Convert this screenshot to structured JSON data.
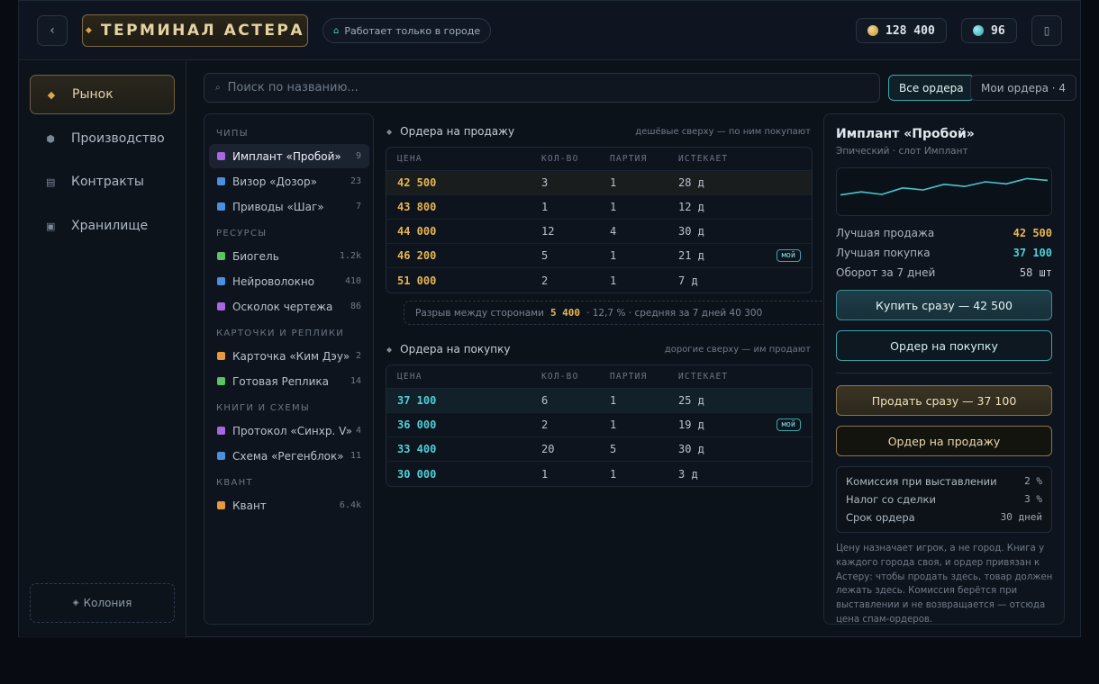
{
  "header": {
    "back_label": "‹",
    "title": "ТЕРМИНАЛ АСТЕРА",
    "city_note": "Работает только в городе",
    "gold": "128 400",
    "gems": "96",
    "menu_label": "▯"
  },
  "sidebar": {
    "items": [
      {
        "label": "Рынок",
        "icon": "diamond-icon"
      },
      {
        "label": "Производство",
        "icon": "hexagon-icon"
      },
      {
        "label": "Контракты",
        "icon": "document-icon"
      },
      {
        "label": "Хранилище",
        "icon": "storage-icon"
      }
    ],
    "colony": "Колония"
  },
  "search": {
    "placeholder": "Поиск по названию..."
  },
  "filters": {
    "all": "Все ордера",
    "mine": "Мои ордера · 4"
  },
  "categories": [
    {
      "title": "ЧИПЫ",
      "items": [
        {
          "name": "Имплант «Пробой»",
          "count": "9",
          "color": "#a866e0"
        },
        {
          "name": "Визор «Дозор»",
          "count": "23",
          "color": "#4a8fe0"
        },
        {
          "name": "Приводы «Шаг»",
          "count": "7",
          "color": "#4a8fe0"
        }
      ]
    },
    {
      "title": "РЕСУРСЫ",
      "items": [
        {
          "name": "Биогель",
          "count": "1.2k",
          "color": "#5cc263"
        },
        {
          "name": "Нейроволокно",
          "count": "410",
          "color": "#4a8fe0"
        },
        {
          "name": "Осколок чертежа",
          "count": "86",
          "color": "#a866e0"
        }
      ]
    },
    {
      "title": "КАРТОЧКИ И РЕПЛИКИ",
      "items": [
        {
          "name": "Карточка «Ким Дэу»",
          "count": "2",
          "color": "#e69a3c"
        },
        {
          "name": "Готовая Реплика",
          "count": "14",
          "color": "#5cc263"
        }
      ]
    },
    {
      "title": "КНИГИ И СХЕМЫ",
      "items": [
        {
          "name": "Протокол «Синхр. V»",
          "count": "4",
          "color": "#a866e0"
        },
        {
          "name": "Схема «Регенблок»",
          "count": "11",
          "color": "#4a8fe0"
        }
      ]
    },
    {
      "title": "КВАНТ",
      "items": [
        {
          "name": "Квант",
          "count": "6.4k",
          "color": "#e69a3c"
        }
      ]
    }
  ],
  "sell": {
    "title": "Ордера на продажу",
    "hint": "дешёвые сверху — по ним покупают",
    "columns": [
      "ЦЕНА",
      "КОЛ-ВО",
      "ПАРТИЯ",
      "ИСТЕКАЕТ"
    ],
    "rows": [
      {
        "price": "42 500",
        "qty": "3",
        "lot": "1",
        "exp": "28 д",
        "mine": ""
      },
      {
        "price": "43 800",
        "qty": "1",
        "lot": "1",
        "exp": "12 д",
        "mine": ""
      },
      {
        "price": "44 000",
        "qty": "12",
        "lot": "4",
        "exp": "30 д",
        "mine": ""
      },
      {
        "price": "46 200",
        "qty": "5",
        "lot": "1",
        "exp": "21 д",
        "mine": "мой"
      },
      {
        "price": "51 000",
        "qty": "2",
        "lot": "1",
        "exp": "7 д",
        "mine": ""
      }
    ]
  },
  "spread": {
    "label": "Разрыв между сторонами",
    "value": "5 400",
    "detail": "· 12,7 % · средняя за 7 дней 40 300"
  },
  "buy": {
    "title": "Ордера на покупку",
    "hint": "дорогие сверху — им продают",
    "columns": [
      "ЦЕНА",
      "КОЛ-ВО",
      "ПАРТИЯ",
      "ИСТЕКАЕТ"
    ],
    "rows": [
      {
        "price": "37 100",
        "qty": "6",
        "lot": "1",
        "exp": "25 д",
        "mine": ""
      },
      {
        "price": "36 000",
        "qty": "2",
        "lot": "1",
        "exp": "19 д",
        "mine": "мой"
      },
      {
        "price": "33 400",
        "qty": "20",
        "lot": "5",
        "exp": "30 д",
        "mine": ""
      },
      {
        "price": "30 000",
        "qty": "1",
        "lot": "1",
        "exp": "3 д",
        "mine": ""
      }
    ]
  },
  "detail": {
    "title": "Имплант «Пробой»",
    "subtitle": "Эпический · слот Имплант",
    "sparkline": [
      0.3,
      0.42,
      0.32,
      0.58,
      0.5,
      0.72,
      0.64,
      0.82,
      0.74,
      0.95,
      0.88
    ],
    "best_sell_label": "Лучшая продажа",
    "best_sell": "42 500",
    "best_buy_label": "Лучшая покупка",
    "best_buy": "37 100",
    "turnover_label": "Оборот за 7 дней",
    "turnover": "58 шт",
    "buy_now": "Купить сразу — 42 500",
    "buy_order": "Ордер на покупку",
    "sell_now": "Продать сразу — 37 100",
    "sell_order": "Ордер на продажу",
    "fees": [
      {
        "label": "Комиссия при выставлении",
        "value": "2 %"
      },
      {
        "label": "Налог со сделки",
        "value": "3 %"
      },
      {
        "label": "Срок ордера",
        "value": "30 дней"
      }
    ],
    "note": "Цену назначает игрок, а не город. Книга у каждого города своя, и ордер привязан к Астеру: чтобы продать здесь, товар должен лежать здесь. Комиссия берётся при выставлении и не возвращается — отсюда цена спам-ордеров."
  },
  "colors": {
    "gold": "#e8b653",
    "teal": "#4fcfd6",
    "accent_gold": "#d9a84b"
  }
}
